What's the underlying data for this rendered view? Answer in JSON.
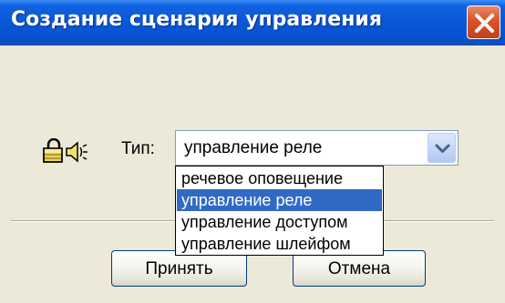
{
  "window": {
    "title": "Создание сценария управления"
  },
  "form": {
    "type_label": "Тип:",
    "type_value": "управление реле",
    "options": [
      "речевое оповещение",
      "управление реле",
      "управление доступом",
      "управление шлейфом"
    ],
    "selected_index": 1
  },
  "buttons": {
    "ok_label": "Принять",
    "cancel_label": "Отмена"
  },
  "icons": {
    "close": "close-icon",
    "lock": "lock-icon",
    "speaker": "speaker-icon",
    "dropdown_arrow": "chevron-down-icon"
  },
  "colors": {
    "titlebar": "#0a58d8",
    "close_button": "#d8542a",
    "selection": "#316ac5",
    "dialog_bg": "#ece9d8"
  }
}
